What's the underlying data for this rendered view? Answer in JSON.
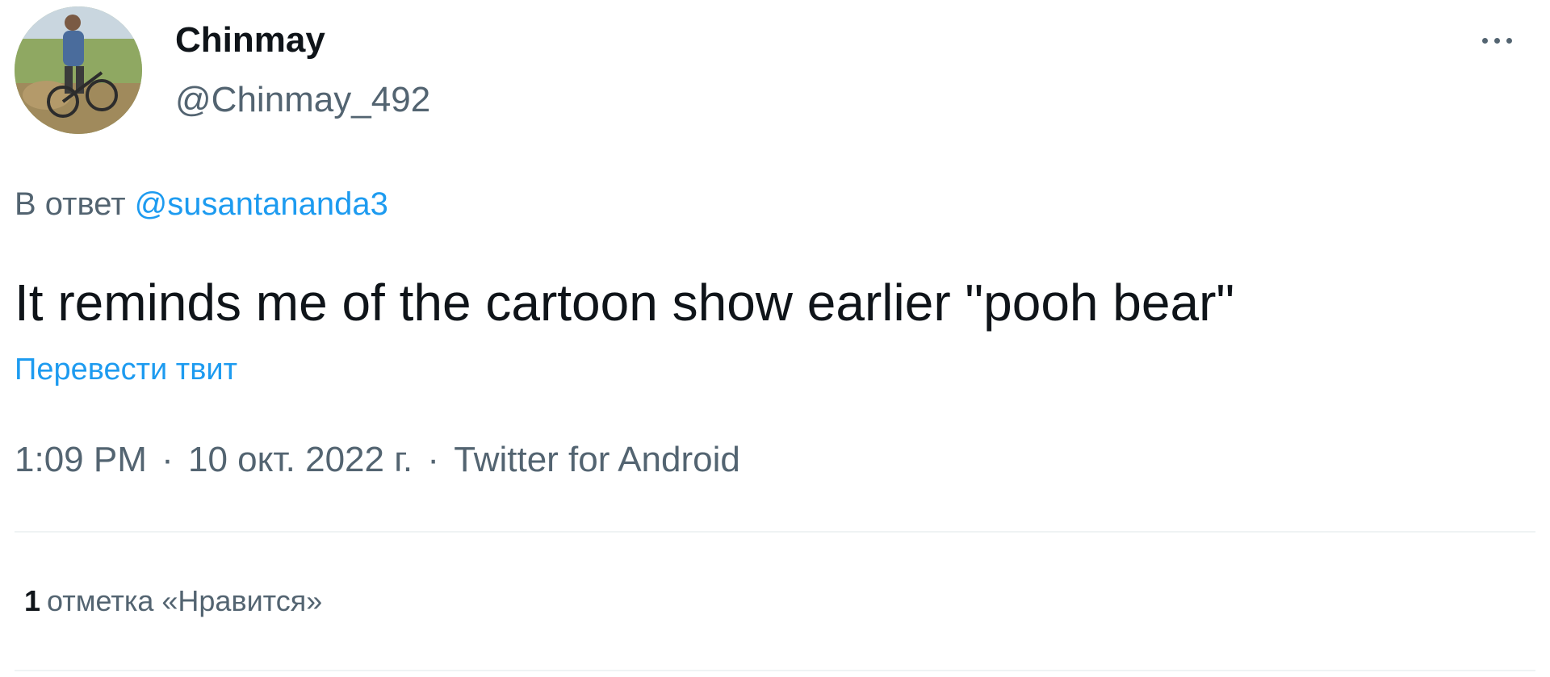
{
  "author": {
    "display_name": "Chinmay",
    "handle": "@Chinmay_492"
  },
  "reply": {
    "prefix": "В ответ",
    "mention": "@susantananda3"
  },
  "tweet": {
    "text": "It reminds me of the cartoon show earlier \"pooh bear\"",
    "translate_label": "Перевести твит"
  },
  "meta": {
    "time": "1:09 PM",
    "separator": "·",
    "date": "10 окт. 2022 г.",
    "source": "Twitter for Android"
  },
  "likes": {
    "count": "1",
    "label": "отметка «Нравится»"
  },
  "icons": {
    "more": "more-horizontal-icon"
  },
  "colors": {
    "text_primary": "#0f1419",
    "text_secondary": "#536471",
    "accent": "#1d9bf0",
    "divider": "#eff3f4"
  }
}
